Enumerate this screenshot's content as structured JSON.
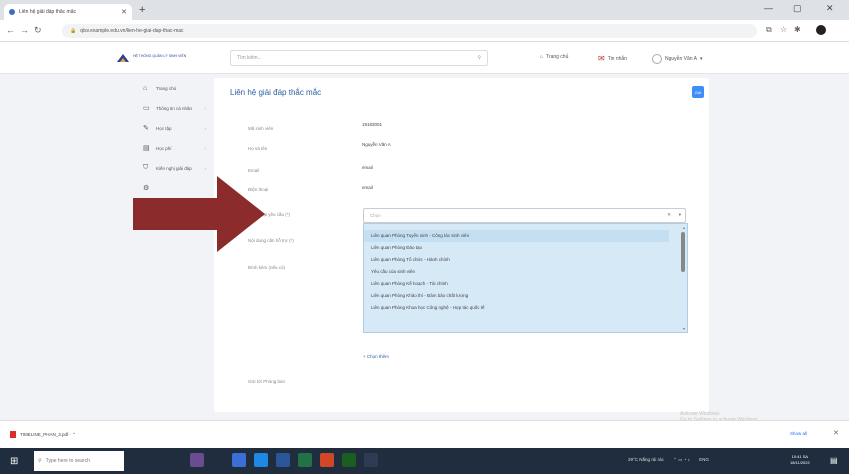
{
  "browser": {
    "tab_title": "Liên hệ giải đáp thắc mắc",
    "new_tab": "+",
    "url": "qlsv.example.edu.vn/lien-he-giai-dap-thac-mac",
    "win_min": "—",
    "win_max": "▢",
    "win_close": "✕"
  },
  "site": {
    "brand": "HỆ THỐNG QUẢN LÝ SINH VIÊN",
    "search_placeholder": "Tìm kiếm...",
    "search_icon_glyph": "⚲",
    "nav_home": "Trang chủ",
    "nav_notify": "Tin nhắn",
    "user_name": "Nguyễn Văn A"
  },
  "sidebar": {
    "items": [
      {
        "icon": "home-icon",
        "glyph": "⌂",
        "label": "Trang chủ",
        "chevron": ""
      },
      {
        "icon": "monitor-icon",
        "glyph": "▭",
        "label": "Thông tin cá nhân",
        "chevron": "›"
      },
      {
        "icon": "study-icon",
        "glyph": "✎",
        "label": "Học tập",
        "chevron": "›"
      },
      {
        "icon": "wallet-icon",
        "glyph": "▤",
        "label": "Học phí",
        "chevron": "›"
      },
      {
        "icon": "filter-icon",
        "glyph": "⛉",
        "label": "Kiến nghị giải đáp",
        "chevron": "›"
      },
      {
        "icon": "settings-icon",
        "glyph": "⚙",
        "label": "",
        "chevron": ""
      }
    ]
  },
  "form": {
    "title": "Liên hệ giải đáp thắc mắc",
    "submit_label": "Gửi",
    "fields": [
      {
        "label": "Mã sinh viên",
        "value": "19183001"
      },
      {
        "label": "Họ và tên",
        "value": "Nguyễn Văn A"
      },
      {
        "label": "Email",
        "value": "email"
      },
      {
        "label": "Điện thoại",
        "value": "email"
      }
    ],
    "request_label": "Chọn loại yêu cầu (*)",
    "content_label": "Nội dung cần hỗ trợ (*)",
    "attachment_label": "Đính kèm (nếu có)",
    "select_placeholder": "Chọn",
    "options": [
      "Liên quan Phòng Tuyển sinh - Công tác sinh viên",
      "Liên quan Phòng Đào tạo",
      "Liên quan Phòng Tổ chức - Hành chính",
      "Yêu cầu của sinh viên",
      "Liên quan Phòng Kế hoạch - Tài chính",
      "Liên quan Phòng Khảo thí - Đảm bảo chất lượng",
      "Liên quan Phòng Khoa học Công nghệ - Hợp tác quốc tế"
    ],
    "add_more": "+ Chọn thêm",
    "send_to_label": "Gửi tới Phòng ban"
  },
  "downloads": {
    "file_name": "TIMELINE_PHAN_3.pdf",
    "show_all": "Show all",
    "close": "✕"
  },
  "watermark": {
    "line1": "Activate Windows",
    "line2": "Go to Settings to activate Windows."
  },
  "taskbar": {
    "search_placeholder": "Type here to search",
    "weather": "29°C Nắng rải rác",
    "language": "ENG",
    "time": "10:41 SA",
    "date": "18/11/2022"
  },
  "colors": {
    "accent": "#2d5fa0",
    "submit_button": "#3e8ef7",
    "dropdown_bg": "#d6e9f7",
    "arrow": "#8b2b2b",
    "taskbar": "#1f2d3e"
  }
}
